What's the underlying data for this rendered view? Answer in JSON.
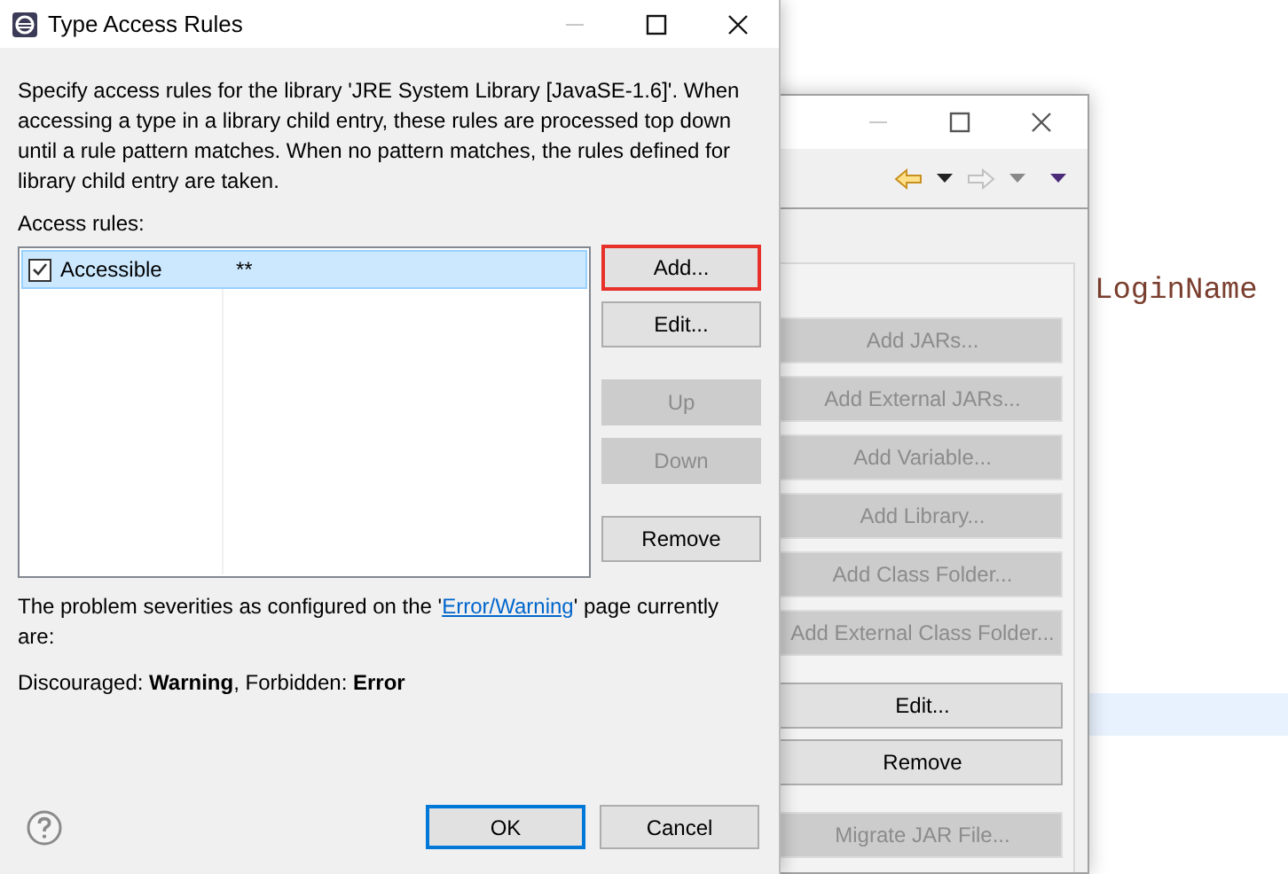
{
  "editor": {
    "code_fragment": "LoginName"
  },
  "background_window": {
    "buttons": [
      {
        "label": "Add JARs...",
        "disabled": true
      },
      {
        "label": "Add External JARs...",
        "disabled": true
      },
      {
        "label": "Add Variable...",
        "disabled": true
      },
      {
        "label": "Add Library...",
        "disabled": true
      },
      {
        "label": "Add Class Folder...",
        "disabled": true
      },
      {
        "label": "Add External Class Folder...",
        "disabled": true
      },
      {
        "label": "Edit...",
        "disabled": false
      },
      {
        "label": "Remove",
        "disabled": false
      },
      {
        "label": "Migrate JAR File...",
        "disabled": true
      }
    ]
  },
  "dialog": {
    "title": "Type Access Rules",
    "description": "Specify access rules for the library 'JRE System Library [JavaSE-1.6]'. When accessing a type in a library child entry, these rules are processed top down until a rule pattern matches. When no pattern matches, the rules defined for library child entry are taken.",
    "list_label": "Access rules:",
    "rules": [
      {
        "label": "Accessible",
        "pattern": "**",
        "checked": true,
        "selected": true
      }
    ],
    "buttons": [
      {
        "label": "Add...",
        "disabled": false,
        "highlighted": true
      },
      {
        "label": "Edit...",
        "disabled": false,
        "highlighted": false
      },
      {
        "label": "Up",
        "disabled": true,
        "highlighted": false
      },
      {
        "label": "Down",
        "disabled": true,
        "highlighted": false
      },
      {
        "label": "Remove",
        "disabled": false,
        "highlighted": false
      }
    ],
    "note_before": "The problem severities as configured on the '",
    "note_link": "Error/Warning",
    "note_after": "' page currently are:",
    "severities": "Discouraged: **Warning**, Forbidden: **Error**",
    "footer_buttons": [
      {
        "label": "OK",
        "default": true
      },
      {
        "label": "Cancel",
        "default": false
      }
    ]
  }
}
